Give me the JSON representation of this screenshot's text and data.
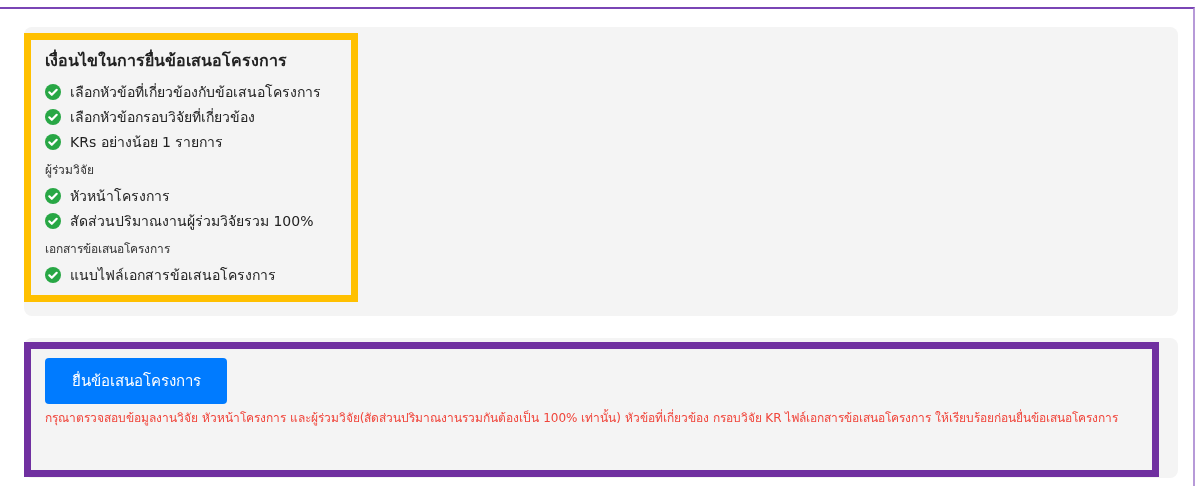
{
  "conditions": {
    "title": "เงื่อนไขในการยื่นข้อเสนอโครงการ",
    "groups": [
      {
        "items": [
          {
            "label": "เลือกหัวข้อที่เกี่ยวข้องกับข้อเสนอโครงการ",
            "checked": true
          },
          {
            "label": "เลือกหัวข้อกรอบวิจัยที่เกี่ยวข้อง",
            "checked": true
          },
          {
            "label": "KRs อย่างน้อย 1 รายการ",
            "checked": true
          }
        ]
      },
      {
        "heading": "ผู้ร่วมวิจัย",
        "items": [
          {
            "label": "หัวหน้าโครงการ",
            "checked": true
          },
          {
            "label": "สัดส่วนปริมาณงานผู้ร่วมวิจัยรวม 100%",
            "checked": true
          }
        ]
      },
      {
        "heading": "เอกสารข้อเสนอโครงการ",
        "items": [
          {
            "label": "แนบไฟล์เอกสารข้อเสนอโครงการ",
            "checked": true
          }
        ]
      }
    ]
  },
  "submit": {
    "button": "ยื่นข้อเสนอโครงการ",
    "warning": "กรุณาตรวจสอบข้อมูลงานวิจัย หัวหน้าโครงการ และผู้ร่วมวิจัย(สัดส่วนปริมาณงานรวมกันต้องเป็น 100% เท่านั้น) หัวข้อที่เกี่ยวข้อง กรอบวิจัย KR ไฟล์เอกสารข้อเสนอโครงการ ให้เรียบร้อยก่อนยื่นข้อเสนอโครงการ"
  }
}
